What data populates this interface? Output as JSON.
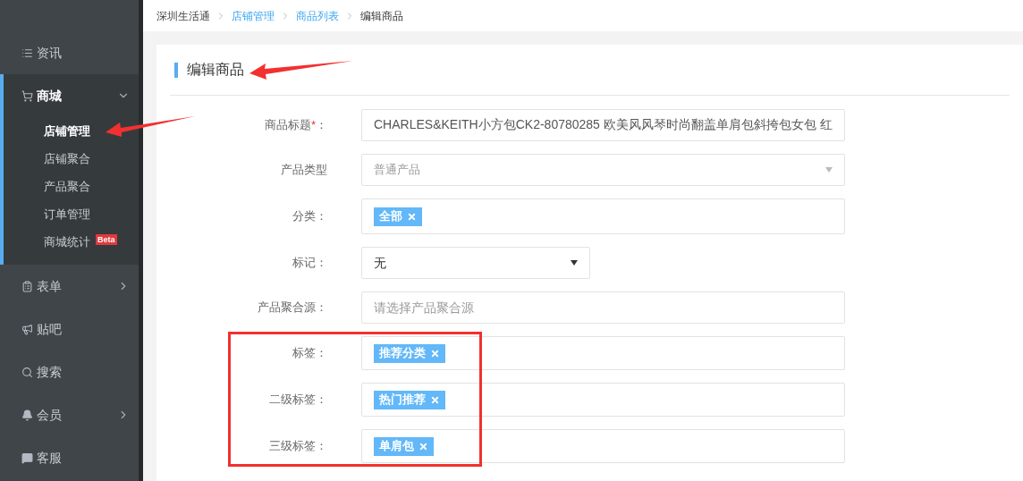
{
  "breadcrumb": [
    {
      "label": "深圳生活通",
      "kind": "plain"
    },
    {
      "label": "店铺管理",
      "kind": "link"
    },
    {
      "label": "商品列表",
      "kind": "link"
    },
    {
      "label": "编辑商品",
      "kind": "current"
    }
  ],
  "sidebar": {
    "items": [
      {
        "label": "资讯",
        "has_arrow": false,
        "expanded": false
      },
      {
        "label": "商城",
        "has_arrow": true,
        "expanded": true,
        "children": [
          {
            "label": "店铺管理",
            "selected": true
          },
          {
            "label": "店铺聚合",
            "selected": false
          },
          {
            "label": "产品聚合",
            "selected": false
          },
          {
            "label": "订单管理",
            "selected": false
          },
          {
            "label": "商城统计",
            "selected": false,
            "badge": "Beta"
          }
        ]
      },
      {
        "label": "表单",
        "has_arrow": true,
        "expanded": false
      },
      {
        "label": "贴吧",
        "has_arrow": false,
        "expanded": false
      },
      {
        "label": "搜索",
        "has_arrow": false,
        "expanded": false
      },
      {
        "label": "会员",
        "has_arrow": true,
        "expanded": false
      },
      {
        "label": "客服",
        "has_arrow": false,
        "expanded": false
      }
    ]
  },
  "page_title": "编辑商品",
  "form": [
    {
      "label": "商品标题",
      "required_mark": "*",
      "colon": "：",
      "kind": "text",
      "value": "CHARLES&KEITH小方包CK2-80780285 欧美风风琴时尚翻盖单肩包斜挎包女包 红"
    },
    {
      "label": "产品类型",
      "kind": "select",
      "disabled": true,
      "value": "普通产品"
    },
    {
      "label": "分类",
      "colon": "：",
      "kind": "tags",
      "tags": [
        "全部"
      ]
    },
    {
      "label": "标记",
      "colon": "：",
      "kind": "select",
      "disabled": false,
      "value": "无"
    },
    {
      "label": "产品聚合源",
      "colon": "：",
      "kind": "text",
      "placeholder": "请选择产品聚合源"
    },
    {
      "label": "标签",
      "colon": "：",
      "kind": "tags",
      "tags": [
        "推荐分类"
      ]
    },
    {
      "label": "二级标签",
      "colon": "：",
      "kind": "tags",
      "tags": [
        "热门推荐"
      ]
    },
    {
      "label": "三级标签",
      "colon": "：",
      "kind": "tags",
      "tags": [
        "单肩包"
      ]
    }
  ]
}
